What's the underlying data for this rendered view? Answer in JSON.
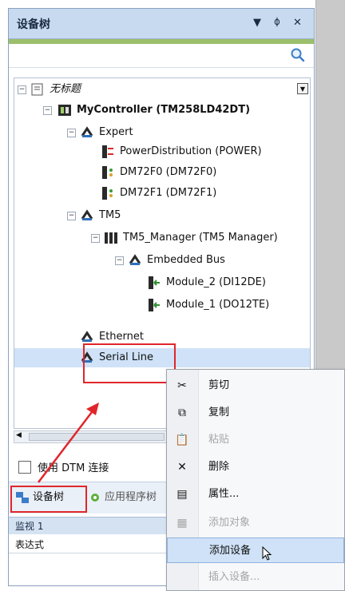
{
  "panel": {
    "title": "设备树",
    "ctrl_down": "▼",
    "ctrl_pin": "ᛰ",
    "ctrl_close": "✕"
  },
  "search": {
    "placeholder": ""
  },
  "tree": [
    {
      "id": "root",
      "label": "无标题",
      "italic": true,
      "expander": "−"
    },
    {
      "id": "controller",
      "label": "MyController (TM258LD42DT)",
      "bold": true,
      "expander": "−"
    },
    {
      "id": "expert",
      "label": "Expert",
      "expander": "−"
    },
    {
      "id": "powerdist",
      "label": "PowerDistribution (POWER)"
    },
    {
      "id": "dm72f0",
      "label": "DM72F0 (DM72F0)"
    },
    {
      "id": "dm72f1",
      "label": "DM72F1 (DM72F1)"
    },
    {
      "id": "tm5",
      "label": "TM5",
      "expander": "−"
    },
    {
      "id": "tm5mgr",
      "label": "TM5_Manager (TM5 Manager)",
      "expander": "−"
    },
    {
      "id": "embbus",
      "label": "Embedded Bus",
      "expander": "−"
    },
    {
      "id": "module2",
      "label": "Module_2 (DI12DE)"
    },
    {
      "id": "module1",
      "label": "Module_1 (DO12TE)"
    },
    {
      "id": "ethernet",
      "label": "Ethernet"
    },
    {
      "id": "serial",
      "label": "Serial Line"
    }
  ],
  "dtm_option": {
    "label": "使用 DTM 连接"
  },
  "bottom_tabs": [
    {
      "label": "设备树"
    },
    {
      "label": "应用程序树"
    }
  ],
  "watch": {
    "title": "监视 1",
    "column": "表达式"
  },
  "context_menu": [
    {
      "label": "剪切",
      "icon": "scissors-icon",
      "glyph": "✂",
      "enabled": true
    },
    {
      "label": "复制",
      "icon": "copy-icon",
      "glyph": "⧉",
      "enabled": true
    },
    {
      "label": "粘贴",
      "icon": "paste-icon",
      "glyph": "📋",
      "enabled": false
    },
    {
      "label": "删除",
      "icon": "delete-icon",
      "glyph": "✕",
      "enabled": true
    },
    {
      "label": "属性...",
      "icon": "properties-icon",
      "glyph": "▤",
      "enabled": true
    },
    {
      "label": "添加对象",
      "icon": "add-object-icon",
      "glyph": "▦",
      "enabled": false
    },
    {
      "label": "添加设备",
      "icon": "add-device-icon",
      "glyph": "",
      "enabled": true,
      "active": true
    },
    {
      "label": "插入设备...",
      "icon": "insert-device-icon",
      "glyph": "",
      "enabled": false
    }
  ],
  "colors": {
    "highlight_red": "#e0262b",
    "title_bg": "#c8daef",
    "selection": "#cfe2f7"
  }
}
